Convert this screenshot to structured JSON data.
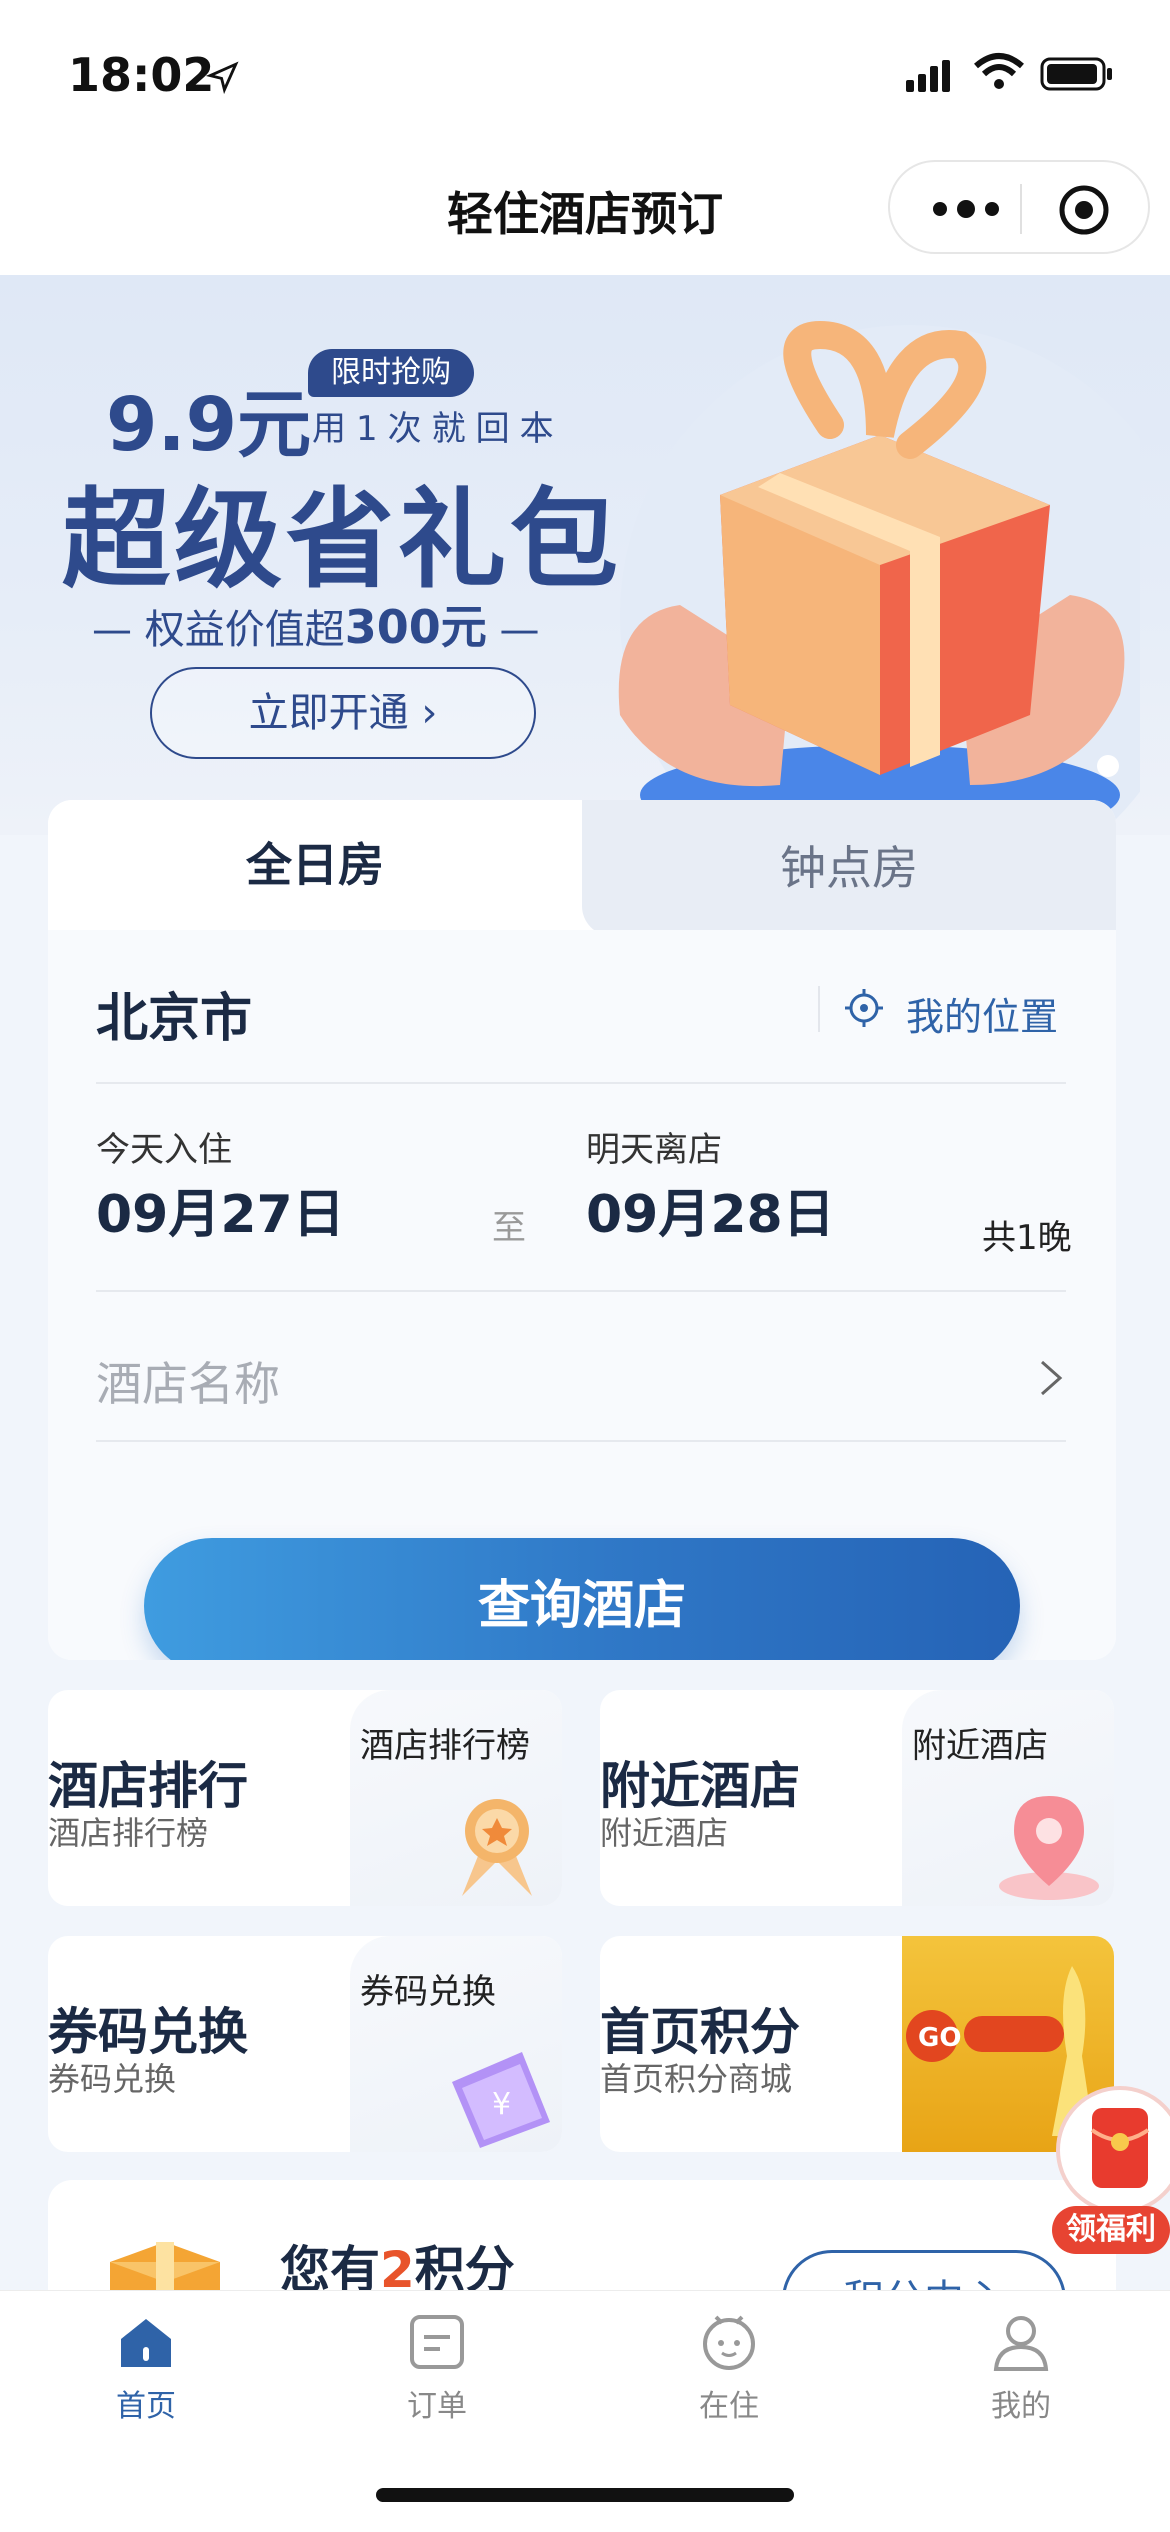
{
  "status_bar": {
    "time": "18:02"
  },
  "nav": {
    "title": "轻住酒店预订"
  },
  "banner": {
    "price": "9.9元",
    "tag": "限时抢购",
    "subtitle": "用1次就回本",
    "main_title": "超级省礼包",
    "value_prefix": "— 权益价值超",
    "value_amount": "300元",
    "value_suffix": "—",
    "cta": "立即开通 ›"
  },
  "booking": {
    "tabs": [
      {
        "label": "全日房",
        "active": true
      },
      {
        "label": "钟点房",
        "active": false
      }
    ],
    "city": "北京市",
    "my_location": "我的位置",
    "checkin_label": "今天入住",
    "checkin_date": "09月27日",
    "to": "至",
    "checkout_label": "明天离店",
    "checkout_date": "09月28日",
    "nights": "共1晚",
    "hotel_placeholder": "酒店名称",
    "search_button": "查询酒店"
  },
  "tiles": [
    {
      "title": "酒店排行",
      "subtitle": "酒店排行榜",
      "image_label": "酒店排行榜"
    },
    {
      "title": "附近酒店",
      "subtitle": "附近酒店",
      "image_label": "附近酒店"
    },
    {
      "title": "券码兑换",
      "subtitle": "券码兑换",
      "image_label": "券码兑换"
    },
    {
      "title": "首页积分",
      "subtitle": "首页积分商城",
      "image_label": ""
    }
  ],
  "points": {
    "prefix": "您有",
    "count": "2",
    "suffix": "积分",
    "button": "积分中心"
  },
  "float_badge": "领福利",
  "tabbar": [
    {
      "label": "首页",
      "icon": "home-icon",
      "active": true
    },
    {
      "label": "订单",
      "icon": "order-icon",
      "active": false
    },
    {
      "label": "在住",
      "icon": "stay-icon",
      "active": false
    },
    {
      "label": "我的",
      "icon": "profile-icon",
      "active": false
    }
  ],
  "colors": {
    "primary": "#2f63a8",
    "banner_text": "#2e4a8c",
    "accent": "#e8542b"
  }
}
